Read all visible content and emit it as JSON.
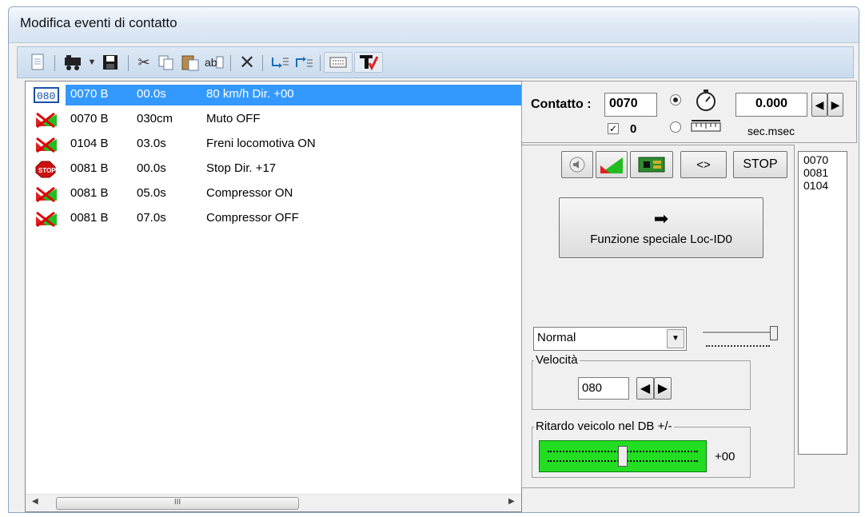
{
  "window": {
    "title": "Modifica eventi di contatto"
  },
  "toolbar": {
    "icons": [
      "new-document-icon",
      "locomotive-icon",
      "dropdown-arrow-icon",
      "save-icon",
      "cut-icon",
      "copy-icon",
      "paste-icon",
      "paste-special-icon",
      "delete-icon",
      "move-down-icon",
      "move-up-icon",
      "keyboard-icon",
      "text-check-icon"
    ]
  },
  "events": [
    {
      "icon": "speed-080-icon",
      "addr": "0070 B",
      "time": "00.0s",
      "desc": "80 km/h Dir. +00",
      "selected": true
    },
    {
      "icon": "function-icon",
      "addr": "0070 B",
      "time": "030cm",
      "desc": "Muto OFF"
    },
    {
      "icon": "function-icon",
      "addr": "0104 B",
      "time": "03.0s",
      "desc": "Freni locomotiva ON"
    },
    {
      "icon": "stop-sign-icon",
      "addr": "0081 B",
      "time": "00.0s",
      "desc": "Stop Dir. +17"
    },
    {
      "icon": "function-icon",
      "addr": "0081 B",
      "time": "05.0s",
      "desc": "Compressor ON"
    },
    {
      "icon": "function-icon",
      "addr": "0081 B",
      "time": "07.0s",
      "desc": "Compressor OFF"
    }
  ],
  "scrollbar": {
    "thumb_label": "III",
    "left_arrow": "◀",
    "right_arrow": "▶"
  },
  "contact": {
    "label": "Contatto :",
    "value": "0070",
    "checkbox_label": "0",
    "checkbox_checked": true,
    "timer_value": "0.000",
    "timer_unit": "sec.msec"
  },
  "buttons": {
    "swap_label": "<>",
    "stop_label": "STOP",
    "special_arrow": "➡",
    "special_label": "Funzione speciale Loc-ID0"
  },
  "address_list": [
    "0070",
    "0081",
    "0104"
  ],
  "mode_select": {
    "value": "Normal"
  },
  "speed": {
    "label": "Velocità",
    "value": "080"
  },
  "delay": {
    "label": "Ritardo veicolo nel DB +/-",
    "value": "+00"
  },
  "colors": {
    "selection": "#3399ff",
    "delay_slider": "#22dd22",
    "title_bg": "#dfe9f5"
  }
}
